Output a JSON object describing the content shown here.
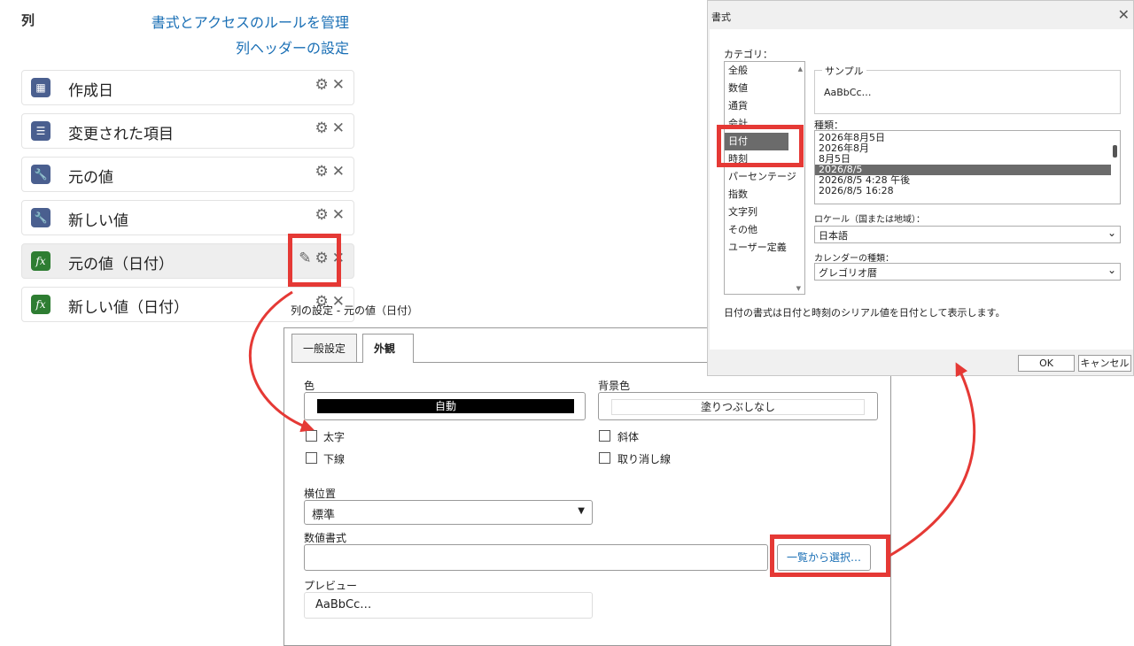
{
  "left_panel": {
    "title": "列",
    "links": [
      "書式とアクセスのルールを管理",
      "列ヘッダーの設定"
    ],
    "items": [
      {
        "label": "作成日",
        "icon": "calendar-icon"
      },
      {
        "label": "変更された項目",
        "icon": "list-icon"
      },
      {
        "label": "元の値",
        "icon": "wrench-icon"
      },
      {
        "label": "新しい値",
        "icon": "wrench-icon"
      },
      {
        "label": "元の値（日付）",
        "icon": "formula-icon"
      },
      {
        "label": "新しい値（日付）",
        "icon": "formula-icon"
      }
    ],
    "formula_glyph": "fx"
  },
  "column_dialog": {
    "title": "列の設定 - 元の値（日付）",
    "tabs": [
      "一般設定",
      "外観"
    ],
    "color_label": "色",
    "color_value": "自動",
    "bg_color_label": "背景色",
    "bg_color_value": "塗りつぶしなし",
    "bold": "太字",
    "underline": "下線",
    "italic": "斜体",
    "strikethrough": "取り消し線",
    "halign_label": "横位置",
    "halign_value": "標準",
    "number_format_label": "数値書式",
    "number_format_value": "",
    "select_button": "一覧から選択…",
    "preview_label": "プレビュー",
    "preview_value": "AaBbCc…"
  },
  "format_dialog": {
    "title": "書式",
    "category_label": "カテゴリ：",
    "categories": [
      "全般",
      "数値",
      "通貨",
      "会計",
      "日付",
      "時刻",
      "パーセンテージ",
      "指数",
      "文字列",
      "その他",
      "ユーザー定義"
    ],
    "selected_category": "日付",
    "sample_label": "サンプル",
    "sample_value": "AaBbCc…",
    "type_label": "種類：",
    "types": [
      "2026年8月5日",
      "2026年8月",
      "8月5日",
      "2026/8/5",
      "2026/8/5 4:28 午後",
      "2026/8/5 16:28"
    ],
    "selected_type": "2026/8/5",
    "locale_label": "ロケール（国または地域）：",
    "locale_value": "日本語",
    "calendar_label": "カレンダーの種類：",
    "calendar_value": "グレゴリオ暦",
    "description": "日付の書式は日付と時刻のシリアル値を日付として表示します。",
    "ok": "OK",
    "cancel": "キャンセル"
  },
  "colors": {
    "annotation": "#e53935",
    "link": "#1a6fb5",
    "selected": "#6b6b6b"
  }
}
